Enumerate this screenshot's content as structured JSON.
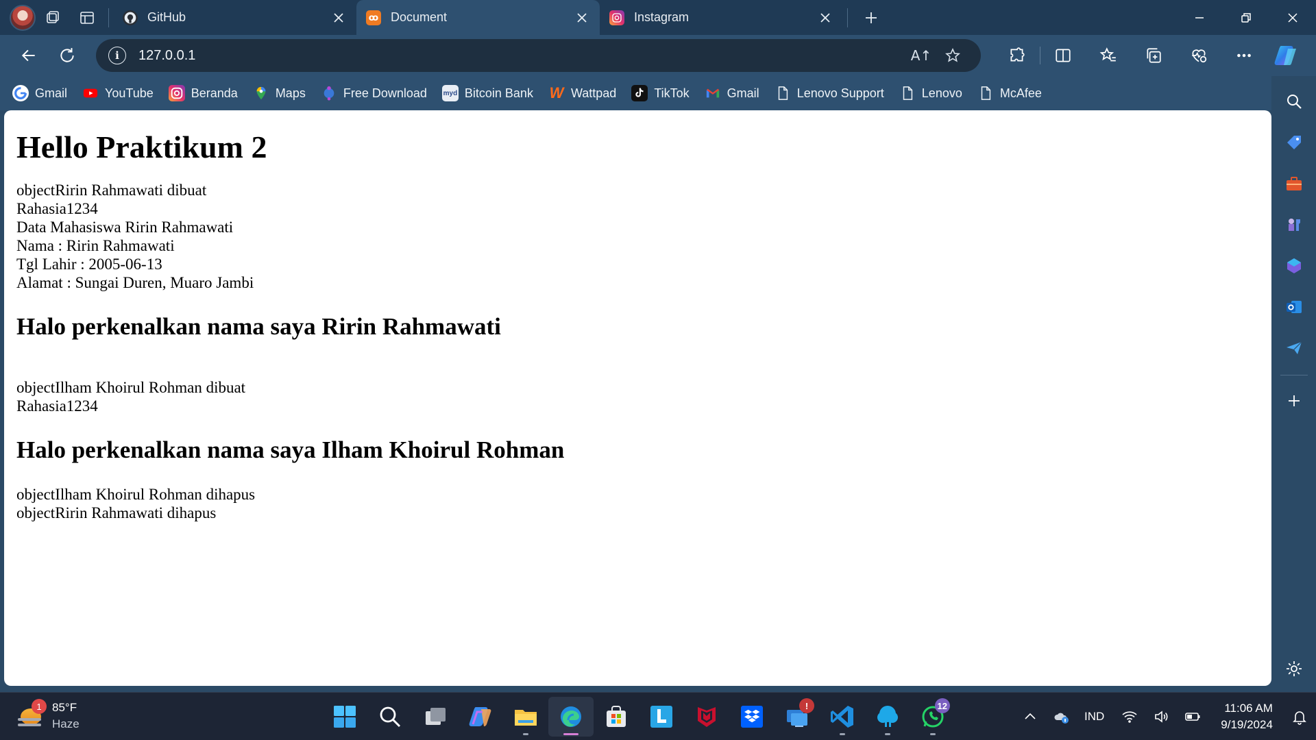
{
  "tabs": [
    {
      "label": "GitHub",
      "icon": "github-icon",
      "active": false
    },
    {
      "label": "Document",
      "icon": "xampp-icon",
      "active": true
    },
    {
      "label": "Instagram",
      "icon": "instagram-icon",
      "active": false
    }
  ],
  "address": {
    "url": "127.0.0.1",
    "read_aloud": "A↑"
  },
  "bookmarks": [
    {
      "label": "Gmail",
      "icon": "google-icon"
    },
    {
      "label": "YouTube",
      "icon": "youtube-icon"
    },
    {
      "label": "Beranda",
      "icon": "instagram-icon"
    },
    {
      "label": "Maps",
      "icon": "maps-pin-icon"
    },
    {
      "label": "Free Download",
      "icon": "free-download-icon"
    },
    {
      "label": "Bitcoin Bank",
      "icon": "bitcoin-bank-icon"
    },
    {
      "label": "Wattpad",
      "icon": "wattpad-icon"
    },
    {
      "label": "TikTok",
      "icon": "tiktok-icon"
    },
    {
      "label": "Gmail",
      "icon": "gmail-icon"
    },
    {
      "label": "Lenovo Support",
      "icon": "page-icon"
    },
    {
      "label": "Lenovo",
      "icon": "page-icon"
    },
    {
      "label": "McAfee",
      "icon": "page-icon"
    }
  ],
  "page": {
    "heading": "Hello Praktikum 2",
    "block1": [
      "objectRirin Rahmawati dibuat",
      "Rahasia1234",
      "Data Mahasiswa Ririn Rahmawati",
      "Nama : Ririn Rahmawati",
      "Tgl Lahir : 2005-06-13",
      "Alamat : Sungai Duren, Muaro Jambi"
    ],
    "intro1": "Halo perkenalkan nama saya Ririn Rahmawati",
    "block2": [
      "objectIlham Khoirul Rohman dibuat",
      "Rahasia1234"
    ],
    "intro2": "Halo perkenalkan nama saya Ilham Khoirul Rohman",
    "block3": [
      "objectIlham Khoirul Rohman dihapus",
      "objectRirin Rahmawati dihapus"
    ]
  },
  "taskbar": {
    "weather_temp": "85°F",
    "weather_cond": "Haze",
    "weather_badge": "1",
    "whatsapp_badge": "12",
    "alert_badge": "!",
    "language": "IND",
    "time": "11:06 AM",
    "date": "9/19/2024"
  },
  "colors": {
    "tab_strip": "#1f3a55",
    "toolbar": "#2e5070",
    "taskbar": "#1d2535",
    "edge_indicator": "#d77fd6"
  }
}
